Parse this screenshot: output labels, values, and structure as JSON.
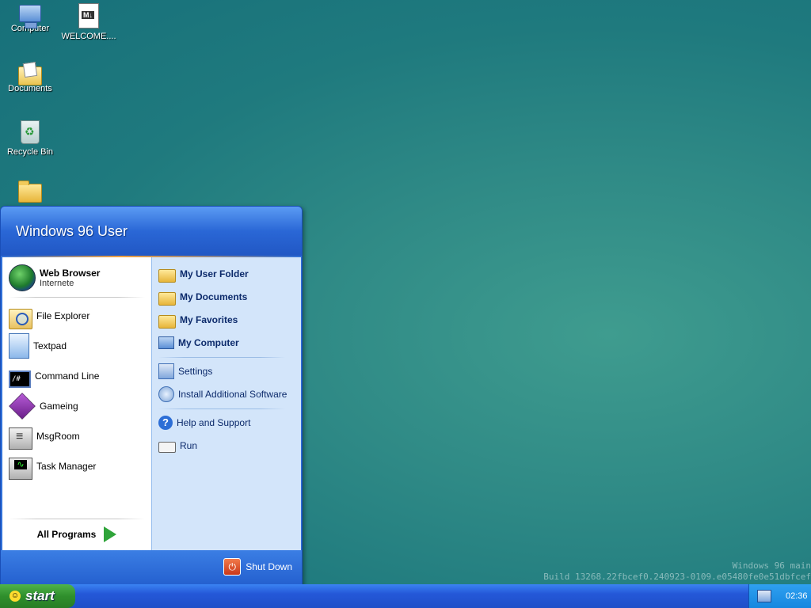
{
  "desktop": {
    "icons": [
      {
        "label": "Computer",
        "icon": "computer-icon"
      },
      {
        "label": "WELCOME....",
        "icon": "markdown-file-icon"
      },
      {
        "label": "Documents",
        "icon": "documents-folder-icon"
      },
      {
        "label": "Recycle Bin",
        "icon": "recycle-bin-icon"
      },
      {
        "label": "",
        "icon": "folder-icon"
      }
    ],
    "watermark": {
      "line1": "Windows 96 main",
      "line2": "Build 13268.22fbcef0.240923-0109.e05480fe0e51dbfcef"
    }
  },
  "start_menu": {
    "user": "Windows 96 User",
    "left_items": [
      {
        "label": "Web Browser",
        "sub": "Internete",
        "icon": "globe-icon"
      },
      {
        "label": "File Explorer",
        "icon": "file-explorer-icon"
      },
      {
        "label": "Textpad",
        "icon": "notepad-icon"
      },
      {
        "label": "Command Line",
        "icon": "terminal-icon"
      },
      {
        "label": "Gameing",
        "icon": "cube-icon"
      },
      {
        "label": "MsgRoom",
        "icon": "chat-computer-icon"
      },
      {
        "label": "Task Manager",
        "icon": "task-monitor-icon"
      }
    ],
    "all_programs": "All Programs",
    "right_items": [
      {
        "label": "My User Folder",
        "icon": "folder-icon"
      },
      {
        "label": "My Documents",
        "icon": "documents-folder-icon"
      },
      {
        "label": "My Favorites",
        "icon": "folder-icon"
      },
      {
        "label": "My Computer",
        "icon": "computer-icon"
      },
      {
        "label": "Settings",
        "icon": "settings-icon"
      },
      {
        "label": "Install Additional Software",
        "icon": "install-icon"
      },
      {
        "label": "Help and Support",
        "icon": "help-icon"
      },
      {
        "label": "Run",
        "icon": "run-icon"
      }
    ],
    "shutdown": "Shut Down"
  },
  "taskbar": {
    "start_label": "start",
    "clock": "02:36"
  },
  "colors": {
    "desktop_bg": "#2f8a86",
    "taskbar_blue": "#2458d8",
    "start_green": "#2f8f2c",
    "menu_right_bg": "#d3e5fa"
  }
}
